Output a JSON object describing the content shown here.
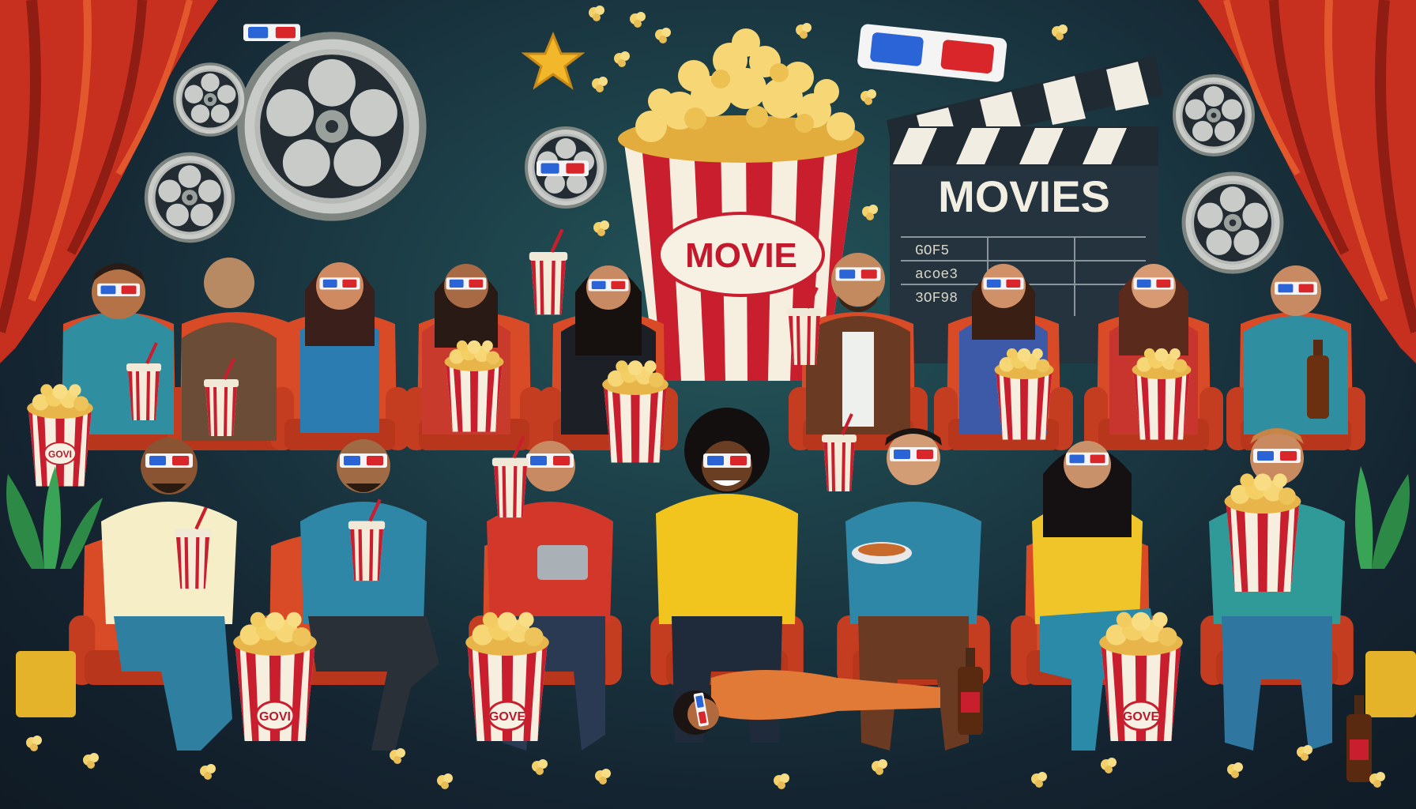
{
  "scene": {
    "big_popcorn_label": "MOVIE",
    "slate_title": "MOVIES",
    "slate_lines": [
      "GOF5",
      "acoe3",
      "3OF98"
    ],
    "floor_popcorn_labels": [
      "GOVI",
      "GOVE",
      "GOVE"
    ],
    "row_cup_label": "GOVI"
  },
  "colors": {
    "curtain": "#c7301f",
    "seat": "#d94a26",
    "popcorn_stripe": "#c81e2e",
    "popcorn_kernel": "#f2c14a",
    "glasses_left": "#2a64d6",
    "glasses_right": "#d8262a"
  },
  "icons": [
    "film-reel-icon",
    "star-icon",
    "3d-glasses-icon",
    "clapperboard-icon",
    "popcorn-bucket-icon",
    "drink-cup-icon",
    "bottle-icon",
    "plant-icon"
  ]
}
